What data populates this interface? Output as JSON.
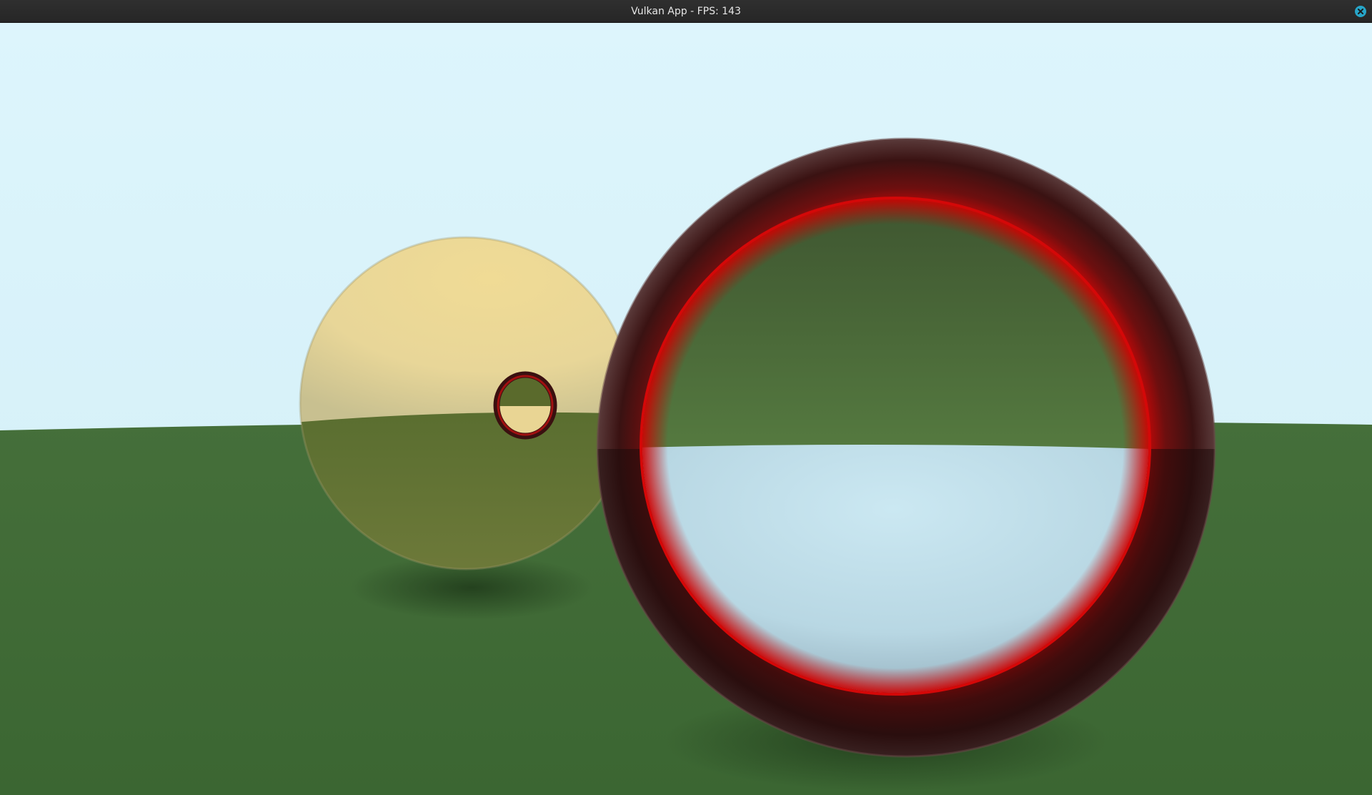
{
  "window": {
    "title": "Vulkan App - FPS: 143",
    "close_icon": "close-icon",
    "accent_color": "#27a5c8"
  },
  "scene": {
    "sky_color": "#daf3fb",
    "ground_color": "#3d6a34",
    "spheres": [
      {
        "name": "yellow-glass-sphere",
        "color": "#e9d792"
      },
      {
        "name": "red-rim-glass-sphere",
        "color": "#b01010"
      },
      {
        "name": "small-red-rim-sphere",
        "color": "#b01010"
      }
    ]
  }
}
